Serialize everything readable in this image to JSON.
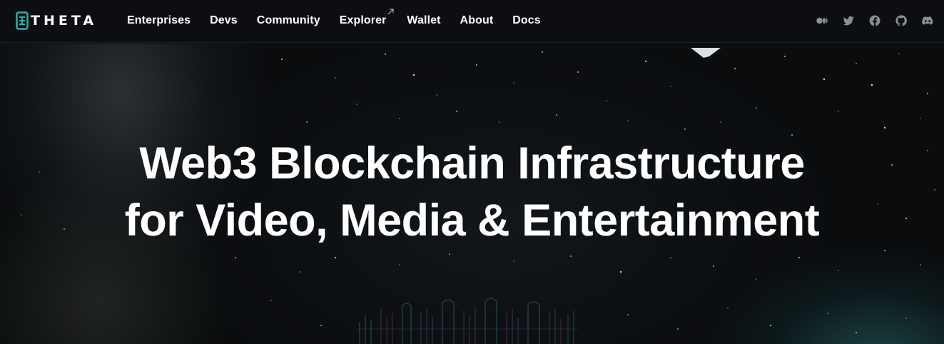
{
  "brand": {
    "name": "THETA",
    "accent": "#29b3aa"
  },
  "nav": {
    "links": [
      {
        "label": "Enterprises",
        "external": false
      },
      {
        "label": "Devs",
        "external": false
      },
      {
        "label": "Community",
        "external": false
      },
      {
        "label": "Explorer",
        "external": true
      },
      {
        "label": "Wallet",
        "external": false
      },
      {
        "label": "About",
        "external": false
      },
      {
        "label": "Docs",
        "external": false
      }
    ],
    "socials": [
      "medium-icon",
      "twitter-icon",
      "facebook-icon",
      "github-icon",
      "discord-icon"
    ]
  },
  "hero": {
    "title_line1": "Web3 Blockchain Infrastructure",
    "title_line2": "for Video, Media & Entertainment"
  }
}
